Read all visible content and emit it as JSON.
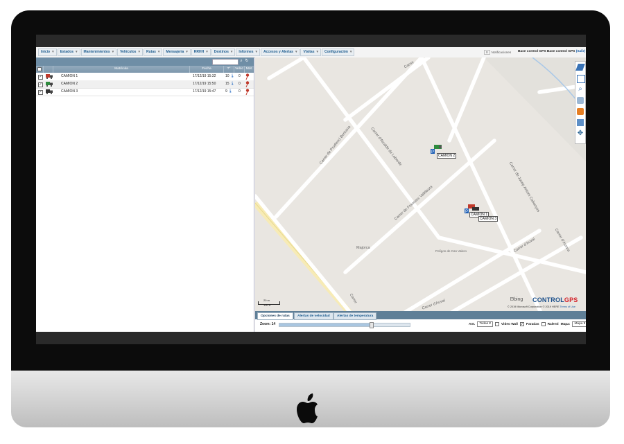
{
  "menu": [
    {
      "label": "Inicio"
    },
    {
      "label": "Estados"
    },
    {
      "label": "Mantenimientos"
    },
    {
      "label": "Vehículos"
    },
    {
      "label": "Rutas"
    },
    {
      "label": "Mensajería"
    },
    {
      "label": "RRHH"
    },
    {
      "label": "Destinos"
    },
    {
      "label": "Informes"
    },
    {
      "label": "Accesos y Alertas"
    },
    {
      "label": "Visitas"
    },
    {
      "label": "Configuración"
    }
  ],
  "menu_arrow": "▾",
  "header": {
    "notif_count": "0",
    "notif_label": "Notificaciones",
    "company": "Base control GPS Base control GPS",
    "exit": "(Salir)"
  },
  "table": {
    "columns": {
      "matricula": "Matrícula",
      "fecha": "Fecha",
      "temp": "T°",
      "vel": "Veloc",
      "mot": "Mot."
    },
    "rows": [
      {
        "name": "CAMION 1",
        "date": "17/12/19 15:32",
        "temp": "10",
        "vel": "0",
        "truck_color": "#c0392b"
      },
      {
        "name": "CAMION 2",
        "date": "17/12/19 15:50",
        "temp": "15",
        "vel": "0",
        "truck_color": "#2e8b3d"
      },
      {
        "name": "CAMION 3",
        "date": "17/12/19 15:47",
        "temp": "9",
        "vel": "0",
        "truck_color": "#333333"
      }
    ]
  },
  "map": {
    "vehicle_labels": [
      "CAMION 2",
      "CAMION 1",
      "CAMION 3"
    ],
    "streets": [
      "Carrer",
      "Carrer de Prudenci Bertrana",
      "Carrer d'Alcalde de Laborde",
      "Carrer de Francesc Valldaura",
      "Carrer de Josep Antoni Cabanyes",
      "Carrer d'Aurora",
      "Carrer d'Auval",
      "Carrer d'Auval",
      "Majorca",
      "Polígon de Can Valero",
      "Carrer"
    ],
    "scale_top": "20 m",
    "scale_bottom": "100 ft",
    "bing": "bing",
    "logo_control": "CONTROL",
    "logo_gps": "GPS",
    "copyright": "© 2019 Microsoft Corporation © 2019 HERE ",
    "terms": "Terms of Use"
  },
  "bottom": {
    "tabs": [
      "Opciones de rutas",
      "Alertas de velocidad",
      "Alertas de temperatura"
    ],
    "zoom_label": "Zoom: 14",
    "zoom_fraction": 0.7,
    "ant_label": "Ant.",
    "ant_value": "Todas",
    "videowall": "Video Wall",
    "paradas": "Paradas",
    "ralenti": "Ralenti",
    "mapa_label": "Mapa:",
    "mapa_value": "Mapa"
  },
  "colors": {
    "accent": "#1d5c8f",
    "header_bar": "#6f8ea6",
    "logo_red": "#d4232a"
  }
}
